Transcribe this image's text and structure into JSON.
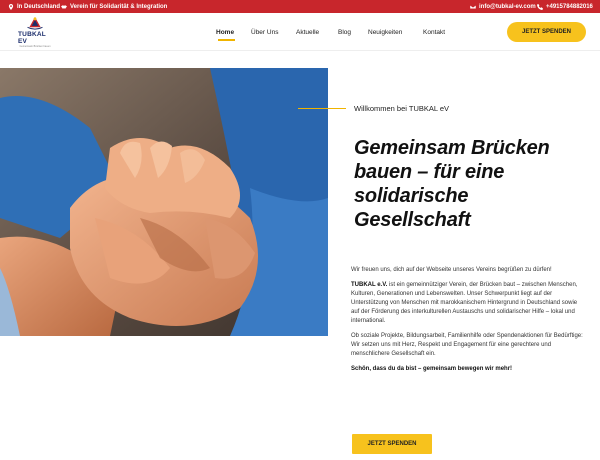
{
  "topbar": {
    "location": "In Deutschland",
    "tagline": "Verein für Solidarität & Integration",
    "email": "info@tubkal-ev.com",
    "phone": "+4915784882016"
  },
  "logo": {
    "brand": "TUBKAL EV",
    "tag": "Gemeinsam Brücken bauen"
  },
  "nav": {
    "items": [
      "Home",
      "Über Uns",
      "Aktuelle",
      "Blog",
      "Neuigkeiten",
      "Kontakt"
    ],
    "active": "Home"
  },
  "header": {
    "cta_label": "JETZT SPENDEN"
  },
  "hero": {
    "image_alt": "Hände halten",
    "welcome": "Willkommen bei TUBKAL eV",
    "headline_lines": [
      "Gemeinsam Brücken",
      "bauen – für eine",
      "solidarische",
      "Gesellschaft"
    ],
    "intro": "Wir freuen uns, dich auf der Webseite unseres Vereins begrüßen zu dürfen!",
    "para1_strong": "TUBKAL e.V.",
    "para1_rest": " ist ein gemeinnütziger Verein, der Brücken baut – zwischen Menschen, Kulturen, Generationen und Lebenswelten. Unser Schwerpunkt liegt auf der Unterstützung von Menschen mit marokkanischem Hintergrund in Deutschland sowie auf der Förderung des interkulturellen Austauschs und solidarischer Hilfe – lokal und international.",
    "para2": "Ob soziale Projekte, Bildungsarbeit, Familienhilfe oder Spendenaktionen für Bedürftige: Wir setzen uns mit Herz, Respekt und Engagement für eine gerechtere und menschlichere Gesellschaft ein.",
    "closing": "Schön, dass du da bist – gemeinsam bewegen wir mehr!",
    "cta_label": "JETZT SPENDEN"
  },
  "colors": {
    "topbar": "#c8262c",
    "accent": "#f7c21d",
    "brand": "#1b2d6b"
  },
  "icons": {
    "location": "map-pin-icon",
    "tagline": "handshake-icon",
    "email": "envelope-icon",
    "phone": "phone-icon"
  }
}
